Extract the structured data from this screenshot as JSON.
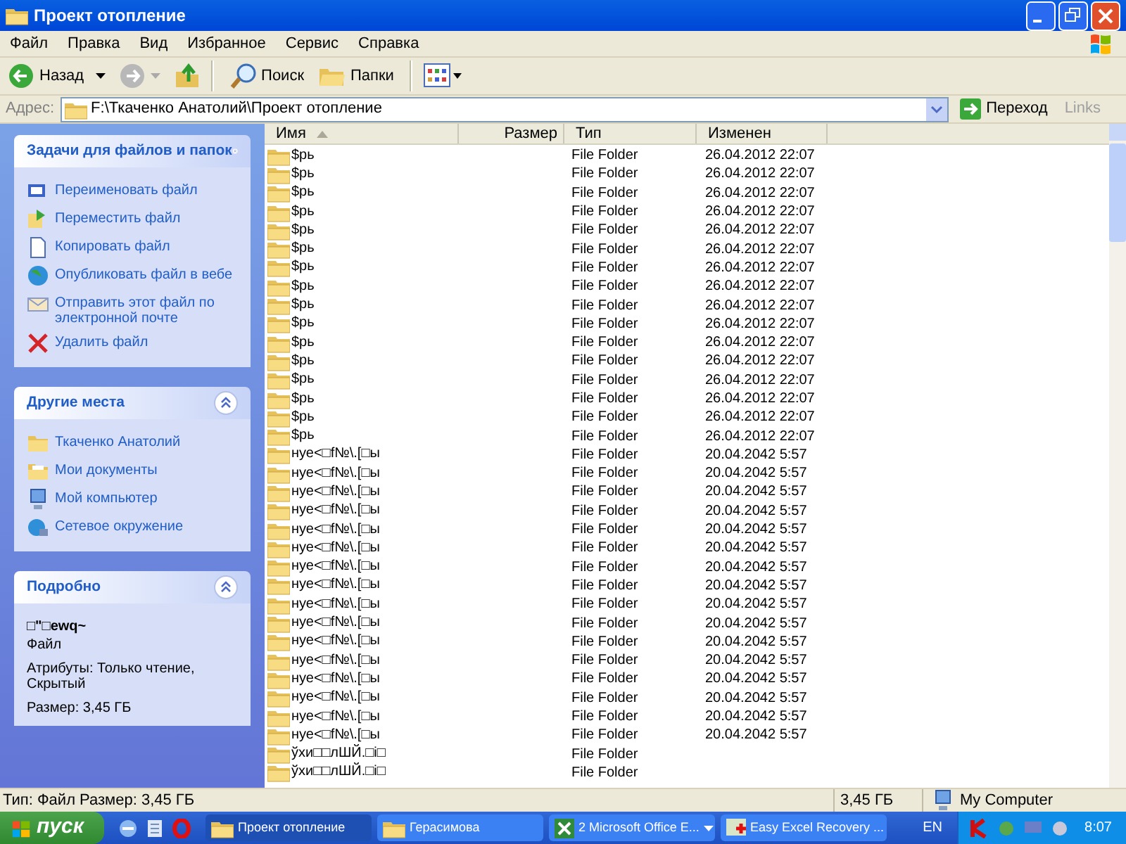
{
  "window": {
    "title": "Проект отопление"
  },
  "menu": [
    "Файл",
    "Правка",
    "Вид",
    "Избранное",
    "Сервис",
    "Справка"
  ],
  "toolbar": {
    "back": "Назад",
    "search": "Поиск",
    "folders": "Папки"
  },
  "address": {
    "label": "Адрес:",
    "value": "F:\\Ткаченко Анатолий\\Проект отопление",
    "go": "Переход",
    "links": "Links"
  },
  "sidebar": [
    {
      "title": "Задачи для файлов и папок",
      "items": [
        {
          "kind": "rename",
          "label": "Переименовать файл"
        },
        {
          "kind": "move",
          "label": "Переместить файл"
        },
        {
          "kind": "copy",
          "label": "Копировать файл"
        },
        {
          "kind": "web",
          "label": "Опубликовать файл в вебе"
        },
        {
          "kind": "mail",
          "label": "Отправить этот файл по электронной почте"
        },
        {
          "kind": "delete",
          "label": "Удалить файл"
        }
      ]
    },
    {
      "title": "Другие места",
      "items": [
        {
          "kind": "folder",
          "label": "Ткаченко Анатолий"
        },
        {
          "kind": "docs",
          "label": "Мои документы"
        },
        {
          "kind": "computer",
          "label": "Мой компьютер"
        },
        {
          "kind": "network",
          "label": "Сетевое окружение"
        }
      ]
    }
  ],
  "details": {
    "title": "Подробно",
    "name": "□\"□ewq~",
    "type": "Файл",
    "attributes": "Атрибуты: Только чтение, Скрытый",
    "size": "Размер: 3,45 ГБ"
  },
  "table": {
    "columns": [
      "Имя",
      "Размер",
      "Тип",
      "Изменен"
    ],
    "rows": [
      [
        "$рь",
        "",
        "File Folder",
        "26.04.2012 22:07"
      ],
      [
        "$рь",
        "",
        "File Folder",
        "26.04.2012 22:07"
      ],
      [
        "$рь",
        "",
        "File Folder",
        "26.04.2012 22:07"
      ],
      [
        "$рь",
        "",
        "File Folder",
        "26.04.2012 22:07"
      ],
      [
        "$рь",
        "",
        "File Folder",
        "26.04.2012 22:07"
      ],
      [
        "$рь",
        "",
        "File Folder",
        "26.04.2012 22:07"
      ],
      [
        "$рь",
        "",
        "File Folder",
        "26.04.2012 22:07"
      ],
      [
        "$рь",
        "",
        "File Folder",
        "26.04.2012 22:07"
      ],
      [
        "$рь",
        "",
        "File Folder",
        "26.04.2012 22:07"
      ],
      [
        "$рь",
        "",
        "File Folder",
        "26.04.2012 22:07"
      ],
      [
        "$рь",
        "",
        "File Folder",
        "26.04.2012 22:07"
      ],
      [
        "$рь",
        "",
        "File Folder",
        "26.04.2012 22:07"
      ],
      [
        "$рь",
        "",
        "File Folder",
        "26.04.2012 22:07"
      ],
      [
        "$рь",
        "",
        "File Folder",
        "26.04.2012 22:07"
      ],
      [
        "$рь",
        "",
        "File Folder",
        "26.04.2012 22:07"
      ],
      [
        "$рь",
        "",
        "File Folder",
        "26.04.2012 22:07"
      ],
      [
        "нуе<□f№\\.[□ы",
        "",
        "File Folder",
        "20.04.2042 5:57"
      ],
      [
        "нуе<□f№\\.[□ы",
        "",
        "File Folder",
        "20.04.2042 5:57"
      ],
      [
        "нуе<□f№\\.[□ы",
        "",
        "File Folder",
        "20.04.2042 5:57"
      ],
      [
        "нуе<□f№\\.[□ы",
        "",
        "File Folder",
        "20.04.2042 5:57"
      ],
      [
        "нуе<□f№\\.[□ы",
        "",
        "File Folder",
        "20.04.2042 5:57"
      ],
      [
        "нуе<□f№\\.[□ы",
        "",
        "File Folder",
        "20.04.2042 5:57"
      ],
      [
        "нуе<□f№\\.[□ы",
        "",
        "File Folder",
        "20.04.2042 5:57"
      ],
      [
        "нуе<□f№\\.[□ы",
        "",
        "File Folder",
        "20.04.2042 5:57"
      ],
      [
        "нуе<□f№\\.[□ы",
        "",
        "File Folder",
        "20.04.2042 5:57"
      ],
      [
        "нуе<□f№\\.[□ы",
        "",
        "File Folder",
        "20.04.2042 5:57"
      ],
      [
        "нуе<□f№\\.[□ы",
        "",
        "File Folder",
        "20.04.2042 5:57"
      ],
      [
        "нуе<□f№\\.[□ы",
        "",
        "File Folder",
        "20.04.2042 5:57"
      ],
      [
        "нуе<□f№\\.[□ы",
        "",
        "File Folder",
        "20.04.2042 5:57"
      ],
      [
        "нуе<□f№\\.[□ы",
        "",
        "File Folder",
        "20.04.2042 5:57"
      ],
      [
        "нуе<□f№\\.[□ы",
        "",
        "File Folder",
        "20.04.2042 5:57"
      ],
      [
        "нуе<□f№\\.[□ы",
        "",
        "File Folder",
        "20.04.2042 5:57"
      ],
      [
        "ўхи□□лШЙ.□і□",
        "",
        "File Folder",
        ""
      ],
      [
        "ўхи□□лШЙ.□і□",
        "",
        "File Folder",
        ""
      ]
    ]
  },
  "status_bar": [
    "Тип: Файл Размер: 3,45 ГБ",
    "3,45 ГБ",
    "My Computer"
  ],
  "taskbar": {
    "start": "пуск",
    "tasks": [
      {
        "label": "Проект отопление",
        "selected": true,
        "kind": "folder"
      },
      {
        "label": "Герасимова",
        "selected": false,
        "kind": "folder"
      },
      {
        "label": "2 Microsoft Office E...",
        "selected": false,
        "kind": "excel"
      },
      {
        "label": "Easy Excel Recovery ...",
        "selected": false,
        "kind": "recovery"
      }
    ],
    "language": "EN",
    "clock": "8:07"
  }
}
